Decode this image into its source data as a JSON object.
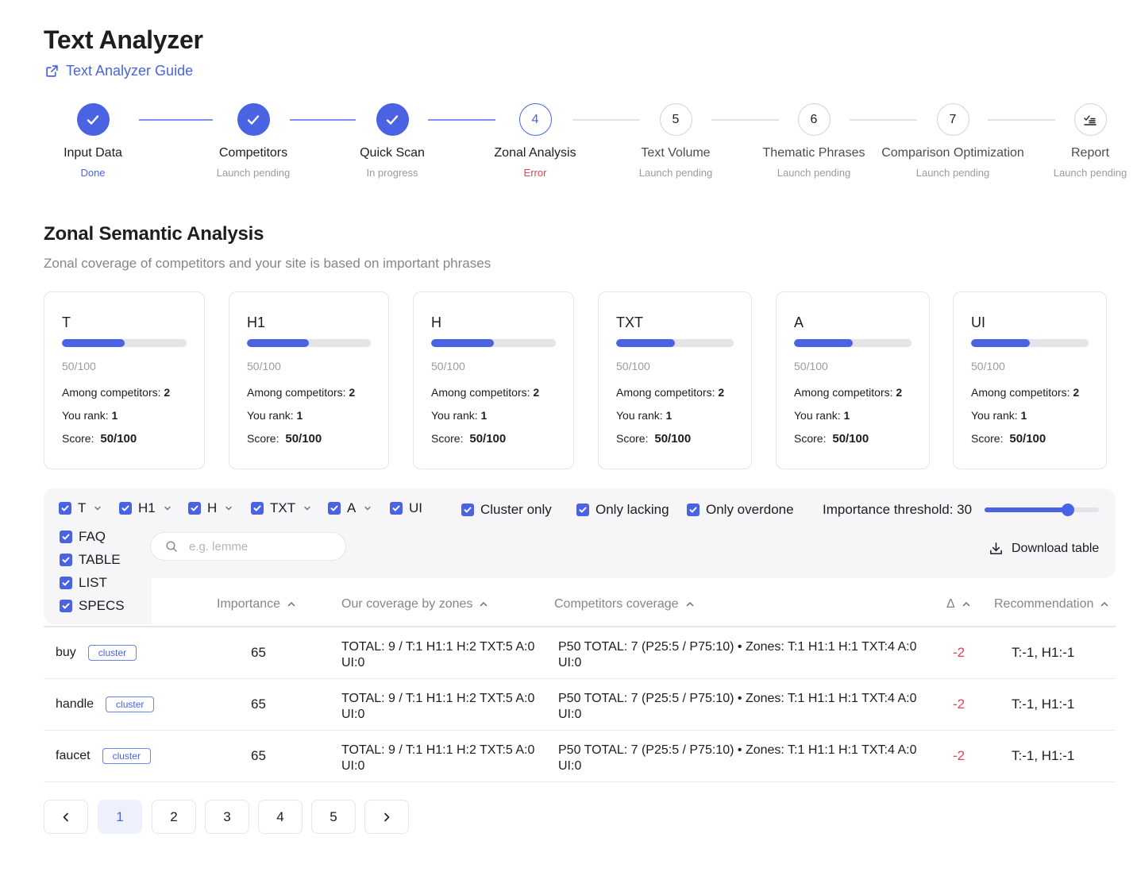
{
  "title": "Text Analyzer",
  "guide_link": "Text Analyzer Guide",
  "steps": [
    {
      "label": "Input Data",
      "status": "Done",
      "state": "done",
      "number": ""
    },
    {
      "label": "Competitors",
      "status": "Launch pending",
      "state": "done",
      "number": ""
    },
    {
      "label": "Quick Scan",
      "status": "In progress",
      "state": "done",
      "number": ""
    },
    {
      "label": "Zonal Analysis",
      "status": "Error",
      "state": "active",
      "number": "4"
    },
    {
      "label": "Text Volume",
      "status": "Launch pending",
      "state": "pending",
      "number": "5"
    },
    {
      "label": "Thematic Phrases",
      "status": "Launch pending",
      "state": "pending",
      "number": "6"
    },
    {
      "label": "Comparison Optimization",
      "status": "Launch pending",
      "state": "pending",
      "number": "7"
    },
    {
      "label": "Report",
      "status": "Launch pending",
      "state": "pending",
      "number": ""
    }
  ],
  "section": {
    "title": "Zonal Semantic Analysis",
    "subtitle": "Zonal coverage of competitors and your site is based on important phrases"
  },
  "cards_labels": {
    "among": "Among competitors:",
    "rank": "You rank:",
    "score": "Score:"
  },
  "cards": [
    {
      "name": "T",
      "progress": 50,
      "score_small": "50/100",
      "among": "2",
      "rank": "1",
      "score": "50/100"
    },
    {
      "name": "H1",
      "progress": 50,
      "score_small": "50/100",
      "among": "2",
      "rank": "1",
      "score": "50/100"
    },
    {
      "name": "H",
      "progress": 50,
      "score_small": "50/100",
      "among": "2",
      "rank": "1",
      "score": "50/100"
    },
    {
      "name": "TXT",
      "progress": 50,
      "score_small": "50/100",
      "among": "2",
      "rank": "1",
      "score": "50/100"
    },
    {
      "name": "A",
      "progress": 50,
      "score_small": "50/100",
      "among": "2",
      "rank": "1",
      "score": "50/100"
    },
    {
      "name": "UI",
      "progress": 50,
      "score_small": "50/100",
      "among": "2",
      "rank": "1",
      "score": "50/100"
    }
  ],
  "filters": {
    "zones": [
      "T",
      "H1",
      "H",
      "TXT",
      "A",
      "UI"
    ],
    "extra_zones": [
      "FAQ",
      "TABLE",
      "LIST",
      "SPECS"
    ],
    "cluster_only": "Cluster only",
    "only_lacking": "Only lacking",
    "only_overdone": "Only overdone",
    "threshold_label": "Importance threshold:",
    "threshold_value": "30",
    "threshold_level": 0.73,
    "search_placeholder": "e.g. lemme",
    "download": "Download table"
  },
  "table": {
    "headers": {
      "importance": "Importance",
      "ours": "Our coverage by zones",
      "competitors": "Competitors coverage",
      "delta": "Δ",
      "recommendation": "Recommendation"
    },
    "rows": [
      {
        "word": "buy",
        "tag": "cluster",
        "importance": "65",
        "ours": "TOTAL: 9 / T:1 H1:1 H:2 TXT:5 A:0 UI:0",
        "competitors": "P50 TOTAL: 7 (P25:5 / P75:10) • Zones: T:1 H1:1 H:1 TXT:4 A:0 UI:0",
        "delta": "-2",
        "recommendation": "T:-1, H1:-1"
      },
      {
        "word": "handle",
        "tag": "cluster",
        "importance": "65",
        "ours": "TOTAL: 9 / T:1 H1:1 H:2 TXT:5 A:0 UI:0",
        "competitors": "P50 TOTAL: 7 (P25:5 / P75:10) • Zones: T:1 H1:1 H:1 TXT:4 A:0 UI:0",
        "delta": "-2",
        "recommendation": "T:-1, H1:-1"
      },
      {
        "word": "faucet",
        "tag": "cluster",
        "importance": "65",
        "ours": "TOTAL: 9 / T:1 H1:1 H:2 TXT:5 A:0 UI:0",
        "competitors": "P50 TOTAL: 7 (P25:5 / P75:10) • Zones: T:1 H1:1 H:1 TXT:4 A:0 UI:0",
        "delta": "-2",
        "recommendation": "T:-1, H1:-1"
      }
    ]
  },
  "pagination": {
    "pages": [
      "1",
      "2",
      "3",
      "4",
      "5"
    ],
    "current": "1"
  },
  "colors": {
    "accent": "#4a63e3",
    "error": "#e0454f",
    "muted": "#85858e"
  }
}
